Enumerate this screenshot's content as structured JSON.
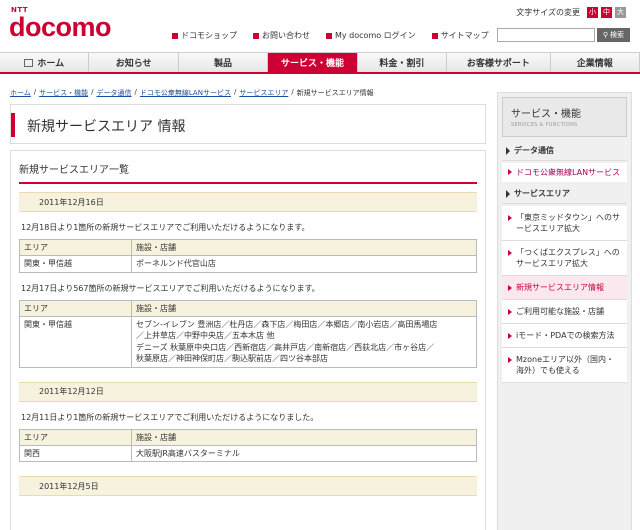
{
  "header": {
    "logo_sub": "NTT",
    "logo_name": "docomo",
    "utility_links": [
      "ドコモショップ",
      "お問い合わせ",
      "My docomo ログイン",
      "サイトマップ"
    ],
    "font_size_label": "文字サイズの変更",
    "font_sizes": [
      "小",
      "中",
      "大"
    ],
    "search_button": "検索",
    "search_value": ""
  },
  "nav": {
    "items": [
      {
        "label": "ホーム"
      },
      {
        "label": "お知らせ"
      },
      {
        "label": "製品"
      },
      {
        "label": "サービス・機能"
      },
      {
        "label": "料金・割引"
      },
      {
        "label": "お客様サポート"
      },
      {
        "label": "企業情報"
      }
    ]
  },
  "breadcrumb": {
    "links": [
      "ホーム",
      "サービス・機能",
      "データ通信",
      "ドコモ公衆無線LANサービス",
      "サービスエリア"
    ],
    "current": "新規サービスエリア情報",
    "separator": "/"
  },
  "page_title": "新規サービスエリア 情報",
  "main": {
    "section_title": "新規サービスエリア一覧",
    "col_area": "エリア",
    "col_facility": "施設・店舗",
    "entries": [
      {
        "date": "2011年12月16日",
        "blocks": [
          {
            "text": "12月18日より1箇所の新規サービスエリアでご利用いただけるようになります。",
            "rows": [
              {
                "area": "関東・甲信越",
                "shops": [
                  "ポーネルンド代官山店"
                ]
              }
            ]
          },
          {
            "text": "12月17日より567箇所の新規サービスエリアでご利用いただけるようになります。",
            "rows": [
              {
                "area": "関東・甲信越",
                "shops": [
                  "セブン-イレブン 豊洲店／杜丹店／森下店／梅田店／本郷店／南小岩店／高田馬場店",
                  "／上井草店／中野中央店／五本木店 他",
                  "デニーズ 秋葉原中央口店／西新宿店／高井戸店／南新宿店／西荻北店／市ヶ谷店／",
                  "秋葉原店／神田神保町店／駒込駅前店／四ツ谷本部店"
                ]
              }
            ]
          }
        ]
      },
      {
        "date": "2011年12月12日",
        "blocks": [
          {
            "text": "12月11日より1箇所の新規サービスエリアでご利用いただけるようになりました。",
            "rows": [
              {
                "area": "関西",
                "shops": [
                  "大阪駅JR高速バスターミナル"
                ]
              }
            ]
          }
        ]
      },
      {
        "date": "2011年12月5日",
        "blocks": []
      }
    ]
  },
  "sidebar": {
    "title": "サービス・機能",
    "subtitle": "SERVICES & FUNCTIONS",
    "category1": "データ通信",
    "selected_item": "ドコモ公衆無線LANサービス",
    "category2": "サービスエリア",
    "items": [
      {
        "label": "「東京ミッドタウン」へのサービスエリア拡大"
      },
      {
        "label": "「つくばエクスプレス」へのサービスエリア拡大"
      },
      {
        "label": "新規サービスエリア情報"
      },
      {
        "label": "ご利用可能な施設・店舗"
      },
      {
        "label": "iモード・PDAでの検索方法"
      },
      {
        "label": "Mzoneエリア以外（国内・海外）でも使える"
      }
    ]
  },
  "colors": {
    "brand": "#cc0033",
    "beige": "#f7f2dd",
    "link": "#1a4e9c"
  }
}
